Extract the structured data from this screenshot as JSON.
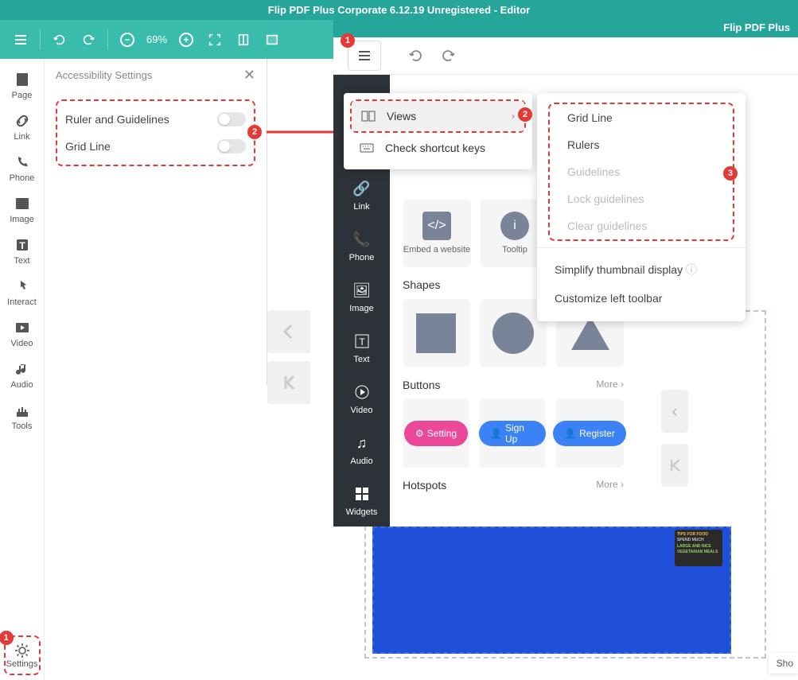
{
  "titlebar": {
    "text": "Flip PDF Plus Corporate 6.12.19 Unregistered - Editor"
  },
  "topbar": {
    "zoom": "69%"
  },
  "left_sidebar": {
    "items": [
      "Page",
      "Link",
      "Phone",
      "Image",
      "Text",
      "Interact",
      "Video",
      "Audio",
      "Tools"
    ],
    "settings_label": "Settings"
  },
  "accessibility": {
    "title": "Accessibility Settings",
    "items": [
      {
        "label": "Ruler and Guidelines"
      },
      {
        "label": "Grid Line"
      }
    ]
  },
  "right_window": {
    "title": "Flip PDF Plus"
  },
  "menu": {
    "views": "Views",
    "shortcut": "Check shortcut keys"
  },
  "submenu": {
    "items": [
      "Grid Line",
      "Rulers",
      "Guidelines",
      "Lock guidelines",
      "Clear guidelines"
    ],
    "simplify": "Simplify thumbnail display",
    "customize": "Customize left toolbar"
  },
  "dark_sidebar": {
    "items": [
      "Link",
      "Phone",
      "Image",
      "Text",
      "Video",
      "Audio",
      "Widgets"
    ]
  },
  "widgets": {
    "embed": {
      "label": "Embed a website"
    },
    "tooltip": {
      "label": "Tooltip"
    },
    "shapes_label": "Shapes",
    "buttons_label": "Buttons",
    "buttons_more": "More",
    "hotspots_label": "Hotspots",
    "hotspots_more": "More",
    "btns": {
      "setting": "Setting",
      "signup": "Sign Up",
      "register": "Register"
    }
  },
  "photo": {
    "line1": "TIPS FOR FOOD",
    "line2": "SPEND MUCH",
    "line3": "LARGE AND NICE",
    "line4": "VEGETARIAN MEALS"
  },
  "sho": "Sho",
  "badges": {
    "b1": "1",
    "b2": "2",
    "b3": "3"
  }
}
